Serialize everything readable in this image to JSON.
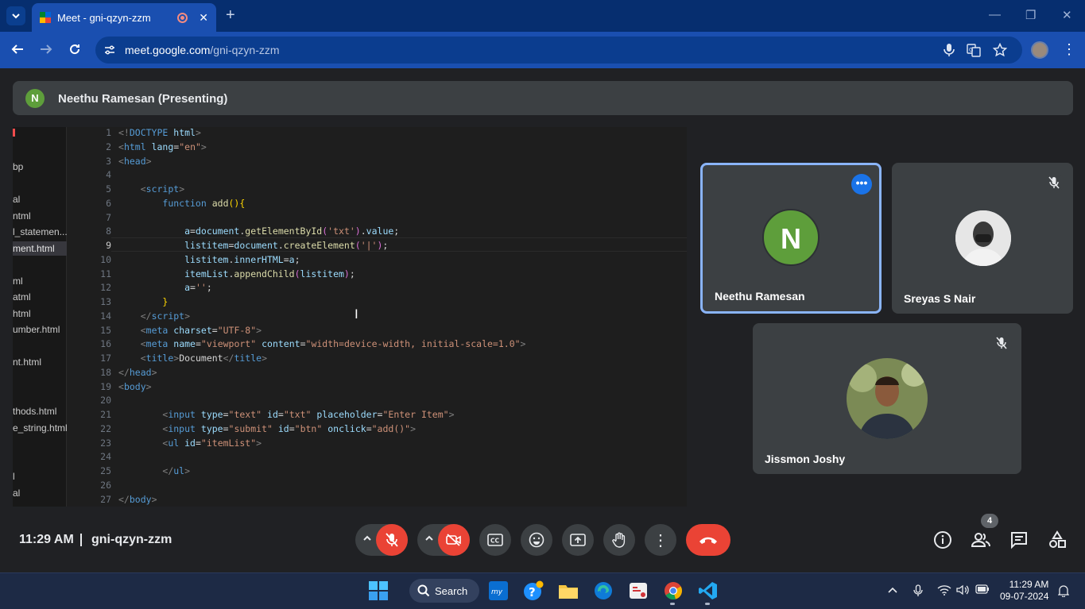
{
  "browser": {
    "tab_title": "Meet - gni-qzyn-zzm",
    "new_tab": "+",
    "url_host": "meet.google.com",
    "url_path": "/gni-qzyn-zzm"
  },
  "presenting": {
    "avatar_letter": "N",
    "label": "Neethu Ramesan (Presenting)"
  },
  "shared_screen": {
    "explorer_files": [
      "bp",
      "al",
      "ntml",
      "l_statemen...",
      "ment.html",
      "ml",
      "ml",
      "atml",
      "html",
      "umber.html",
      "nt.html",
      "thods.html",
      "e_string.html",
      "l",
      "al"
    ],
    "active_file_index": 4,
    "current_line": 9,
    "code_lines": [
      "1",
      "2",
      "3",
      "4",
      "5",
      "6",
      "7",
      "8",
      "9",
      "10",
      "11",
      "12",
      "13",
      "14",
      "15",
      "16",
      "17",
      "18",
      "19",
      "20",
      "21",
      "22",
      "23",
      "24",
      "25",
      "26",
      "27"
    ]
  },
  "participants": [
    {
      "name": "Neethu Ramesan",
      "avatar_letter": "N",
      "active": true
    },
    {
      "name": "Sreyas S Nair",
      "muted": true
    },
    {
      "name": "Jissmon Joshy",
      "muted": true
    }
  ],
  "bottom_bar": {
    "time": "11:29 AM",
    "meeting_code": "gni-qzyn-zzm",
    "people_count": "4"
  },
  "taskbar": {
    "search_label": "Search",
    "time": "11:29 AM",
    "date": "09-07-2024"
  },
  "colors": {
    "accent_blue": "#1a4fb0",
    "end_call_red": "#ea4335",
    "avatar_green": "#5e9e3b",
    "active_tile_border": "#8ab4f8"
  }
}
